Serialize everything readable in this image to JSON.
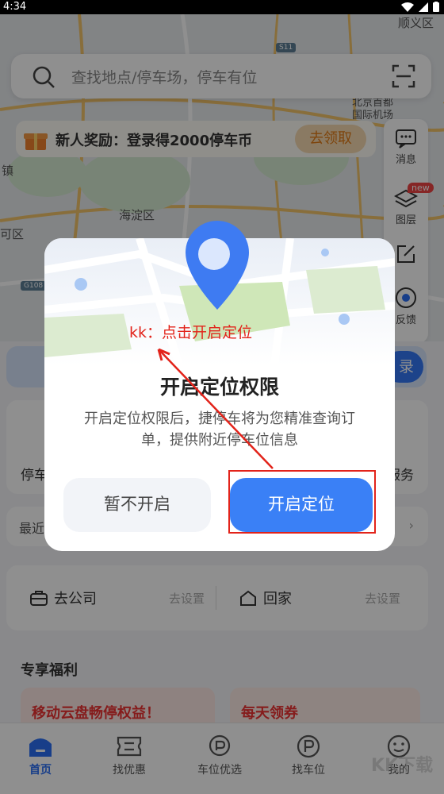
{
  "status_bar": {
    "time": "4:34"
  },
  "map": {
    "labels": [
      "海淀区",
      "镇",
      "可区",
      "顺义区",
      "北京首都",
      "国际机场"
    ],
    "badges": [
      "G108",
      "S11"
    ]
  },
  "search": {
    "placeholder": "查找地点/停车场，停车有位"
  },
  "reward": {
    "text": "新人奖励：登录得2000停车币",
    "button": "去领取"
  },
  "toolbar": {
    "message": "消息",
    "layers": "图层",
    "new_badge": "new",
    "report": "反馈"
  },
  "page": {
    "service_left": "停车",
    "service_right": "服务",
    "recent": "最近",
    "company": "去公司",
    "company_set": "去设置",
    "home": "回家",
    "home_set": "去设置",
    "welfare_title": "专享福利",
    "card1": "移动云盘畅停权益！",
    "card2": "每天领券",
    "blue_go": "录"
  },
  "dialog": {
    "title": "开启定位权限",
    "body": "开启定位权限后，捷停车将为您精准查询订单，提供附近停车位信息",
    "cancel": "暂不开启",
    "confirm": "开启定位"
  },
  "annotation": {
    "text": "kk：点击开启定位"
  },
  "bottom_nav": [
    "首页",
    "找优惠",
    "车位优选",
    "找车位",
    "我的"
  ],
  "watermark": "KK下载",
  "colors": {
    "accent": "#3a80f6",
    "annotation_red": "#e2231a",
    "reward_orange": "#e17b16"
  }
}
